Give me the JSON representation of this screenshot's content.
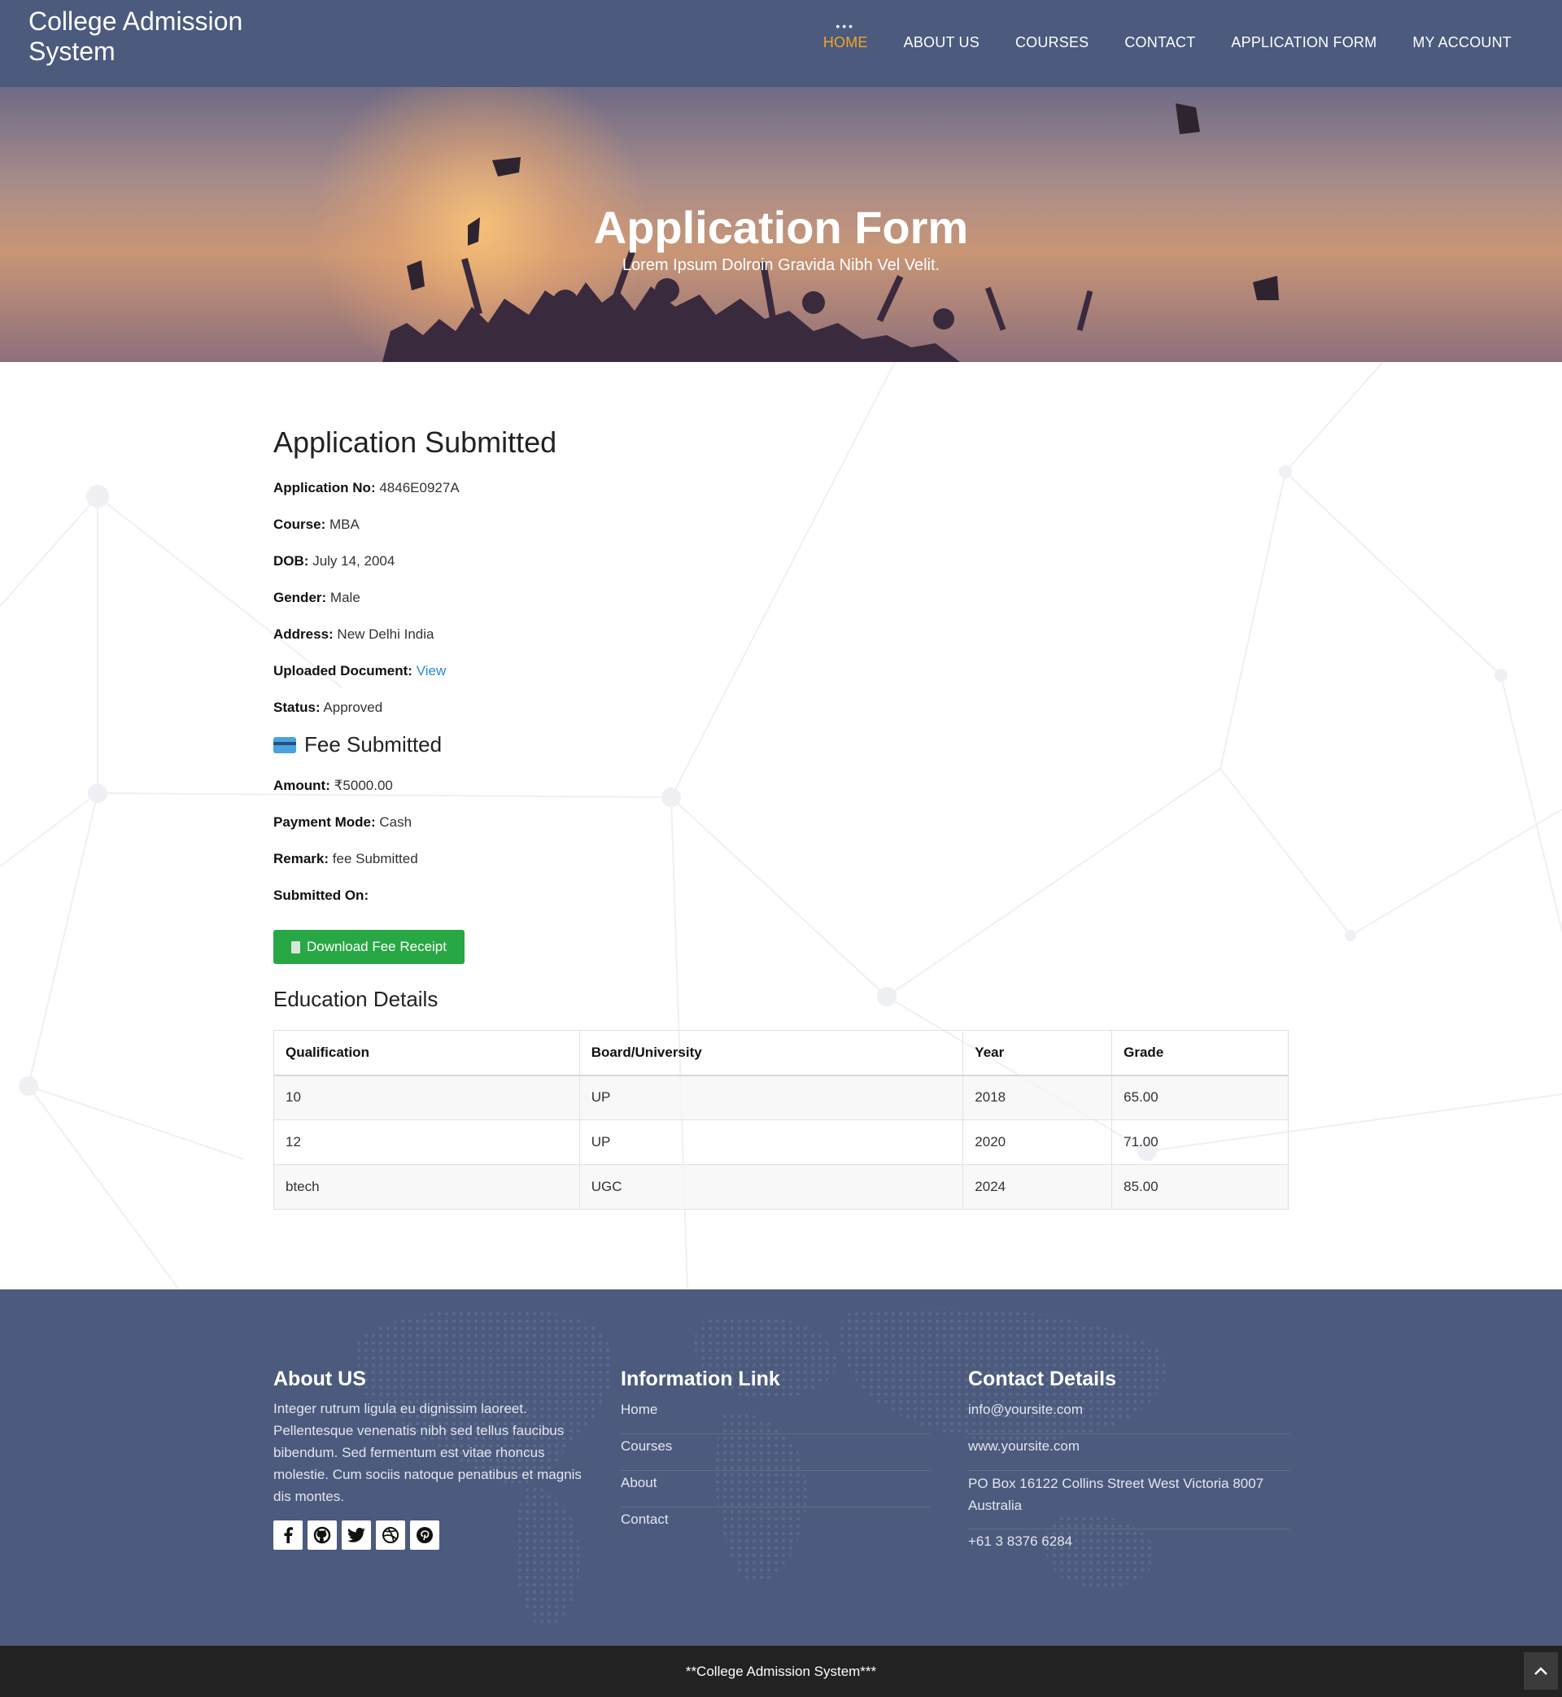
{
  "header": {
    "brand": "College Admission System",
    "nav": [
      {
        "label": "HOME",
        "active": true
      },
      {
        "label": "ABOUT US"
      },
      {
        "label": "COURSES"
      },
      {
        "label": "CONTACT"
      },
      {
        "label": "APPLICATION FORM"
      },
      {
        "label": "MY ACCOUNT"
      }
    ],
    "accent_color": "#f5a623",
    "bg_color": "#4b5a7d"
  },
  "hero": {
    "title": "Application Form",
    "subtitle": "Lorem Ipsum Dolroin Gravida Nibh Vel Velit."
  },
  "application": {
    "heading": "Application Submitted",
    "fields": [
      {
        "label": "Application No:",
        "value": "4846E0927A"
      },
      {
        "label": "Course:",
        "value": "MBA"
      },
      {
        "label": "DOB:",
        "value": "July 14, 2004"
      },
      {
        "label": "Gender:",
        "value": "Male"
      },
      {
        "label": "Address:",
        "value": "New Delhi India"
      },
      {
        "label": "Uploaded Document:",
        "link": "View"
      },
      {
        "label": "Status:",
        "value": "Approved"
      }
    ]
  },
  "fee": {
    "heading": "Fee Submitted",
    "fields": [
      {
        "label": "Amount:",
        "value": "₹5000.00"
      },
      {
        "label": "Payment Mode:",
        "value": "Cash"
      },
      {
        "label": "Remark:",
        "value": "fee Submitted"
      },
      {
        "label": "Submitted On:",
        "value": ""
      }
    ],
    "button_label": "Download Fee Receipt",
    "button_color": "#28a745"
  },
  "education": {
    "heading": "Education Details",
    "columns": [
      "Qualification",
      "Board/University",
      "Year",
      "Grade"
    ],
    "rows": [
      [
        "10",
        "UP",
        "2018",
        "65.00"
      ],
      [
        "12",
        "UP",
        "2020",
        "71.00"
      ],
      [
        "btech",
        "UGC",
        "2024",
        "85.00"
      ]
    ]
  },
  "footer": {
    "about": {
      "heading": "About US",
      "text": "Integer rutrum ligula eu dignissim laoreet. Pellentesque venenatis nibh sed tellus faucibus bibendum. Sed fermentum est vitae rhoncus molestie. Cum sociis natoque penatibus et magnis dis montes.",
      "social": [
        "facebook-icon",
        "github-icon",
        "twitter-icon",
        "dribbble-icon",
        "pinterest-icon"
      ]
    },
    "info": {
      "heading": "Information Link",
      "links": [
        "Home",
        "Courses",
        "About",
        "Contact"
      ]
    },
    "contact": {
      "heading": "Contact Details",
      "items": [
        "info@yoursite.com",
        "www.yoursite.com",
        "PO Box 16122 Collins Street West Victoria 8007 Australia",
        "+61 3 8376 6284"
      ]
    }
  },
  "bottom_bar": {
    "text": "**College Admission System***"
  }
}
